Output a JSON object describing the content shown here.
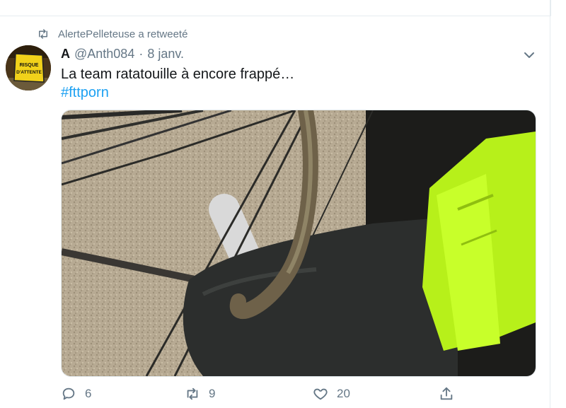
{
  "tweet": {
    "retweeted_by": "AlertePelleteuse a retweeté",
    "author": {
      "name": "A",
      "handle": "@Anth084",
      "avatar_sign_text": "RISQUE D'ATTENTE"
    },
    "separator": "·",
    "date": "8 janv.",
    "text": "La team ratatouille à encore frappé…",
    "hashtag": "#fttporn",
    "media": {
      "description": "photo of a gloved hand holding a cable near a wall"
    },
    "actions": {
      "replies": "6",
      "retweets": "9",
      "likes": "20"
    }
  },
  "colors": {
    "link": "#1da1f2",
    "muted": "#657786",
    "text": "#14171a",
    "border": "#e6ecf0"
  },
  "icons": [
    "retweet-icon",
    "caret-down-icon",
    "reply-icon",
    "like-icon",
    "share-icon"
  ]
}
